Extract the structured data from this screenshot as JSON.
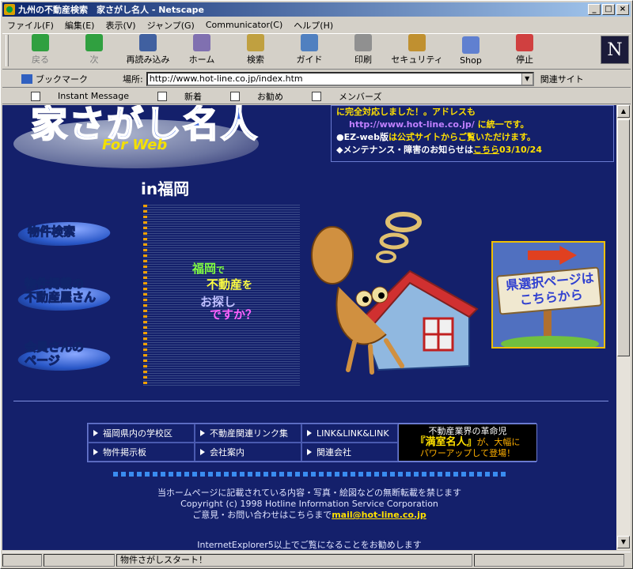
{
  "window": {
    "title": "九州の不動産検索　家さがし名人 - Netscape"
  },
  "menu": [
    "ファイル(F)",
    "編集(E)",
    "表示(V)",
    "ジャンプ(G)",
    "Communicator(C)",
    "ヘルプ(H)"
  ],
  "toolbar": [
    {
      "label": "戻る",
      "icon": "back-arrow-icon",
      "dim": true,
      "color": "#30a040"
    },
    {
      "label": "次",
      "icon": "forward-arrow-icon",
      "dim": true,
      "color": "#30a040"
    },
    {
      "label": "再読み込み",
      "icon": "reload-icon",
      "dim": false,
      "color": "#4060a0"
    },
    {
      "label": "ホーム",
      "icon": "home-icon",
      "dim": false,
      "color": "#8070b0"
    },
    {
      "label": "検索",
      "icon": "search-icon",
      "dim": false,
      "color": "#c0a040"
    },
    {
      "label": "ガイド",
      "icon": "guide-icon",
      "dim": false,
      "color": "#5080c0"
    },
    {
      "label": "印刷",
      "icon": "print-icon",
      "dim": false,
      "color": "#909090"
    },
    {
      "label": "セキュリティ",
      "icon": "lock-icon",
      "dim": false,
      "color": "#c09030"
    },
    {
      "label": "Shop",
      "icon": "shop-icon",
      "dim": false,
      "color": "#6080d0"
    },
    {
      "label": "停止",
      "icon": "stop-icon",
      "dim": false,
      "color": "#d04040"
    }
  ],
  "location": {
    "bookmarks": "ブックマーク",
    "label": "場所:",
    "url": "http://www.hot-line.co.jp/index.htm",
    "related": "関連サイト"
  },
  "personal": [
    "Instant Message",
    "新着",
    "お勧め",
    "メンバーズ"
  ],
  "page": {
    "logo": "家さがし名人",
    "logo_sub": "For Web",
    "news": {
      "line1": "に完全対応しました！。アドレスも",
      "url": "http://www.hot-line.co.jp/",
      "line2": "に統一です。",
      "line3a": "●EZ-web版",
      "line3b": "は公式サイトからご覧いただけます。",
      "line4a": "◆メンテナンス・障害のお知らせは",
      "line4link": "こちら",
      "line4date": "03/10/24"
    },
    "region": "in福岡",
    "left_buttons": [
      "物件検索",
      "物件掲載の\n不動産屋さん",
      "会員さんの\nページ"
    ],
    "cap": {
      "a": "福岡",
      "b": "で",
      "c": "不動産",
      "d": "を",
      "e": "お探し",
      "f": "ですか？"
    },
    "sign": "県選択ページは\nこちらから",
    "links": [
      "福岡県内の学校区",
      "不動産関連リンク集",
      "LINK&LINK&LINK",
      "物件掲示板",
      "会社案内",
      "関連会社"
    ],
    "ad": {
      "l1": "不動産業界の革命児",
      "l2a": "『満室名人』",
      "l2b": "が、大幅に",
      "l3": "パワーアップして登場！"
    },
    "footer": {
      "l1": "当ホームページに記載されている内容・写真・絵図などの無断転載を禁じます",
      "l2": "Copyright (c) 1998 Hotline Information Service Corporation",
      "l3": "ご意見・お問い合わせはこちらまで",
      "mail": "mail@hot-line.co.jp"
    },
    "ie": "InternetExplorer5以上でご覧になることをお勧めします"
  },
  "status": {
    "text": "物件さがしスタート！"
  }
}
